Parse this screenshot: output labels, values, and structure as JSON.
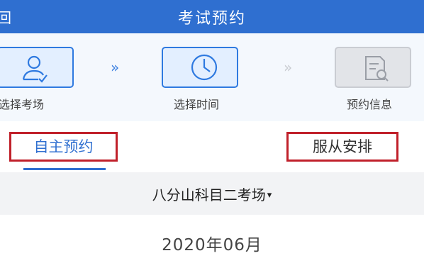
{
  "header": {
    "back_label": "回",
    "title": "考试预约"
  },
  "steps": [
    {
      "label": "选择考场",
      "icon": "person-icon",
      "state": "active"
    },
    {
      "label": "选择时间",
      "icon": "clock-icon",
      "state": "active"
    },
    {
      "label": "预约信息",
      "icon": "document-search-icon",
      "state": "inactive"
    }
  ],
  "arrows": [
    "»",
    "»"
  ],
  "tabs": {
    "self_booking": "自主预约",
    "follow_arrangement": "服从安排"
  },
  "venue": {
    "selected": "八分山科目二考场",
    "caret": "▾"
  },
  "calendar": {
    "month": "2020年06月"
  },
  "colors": {
    "primary": "#2f6fd0",
    "highlight_border": "#c0202a",
    "inactive": "#c8cbd0"
  }
}
